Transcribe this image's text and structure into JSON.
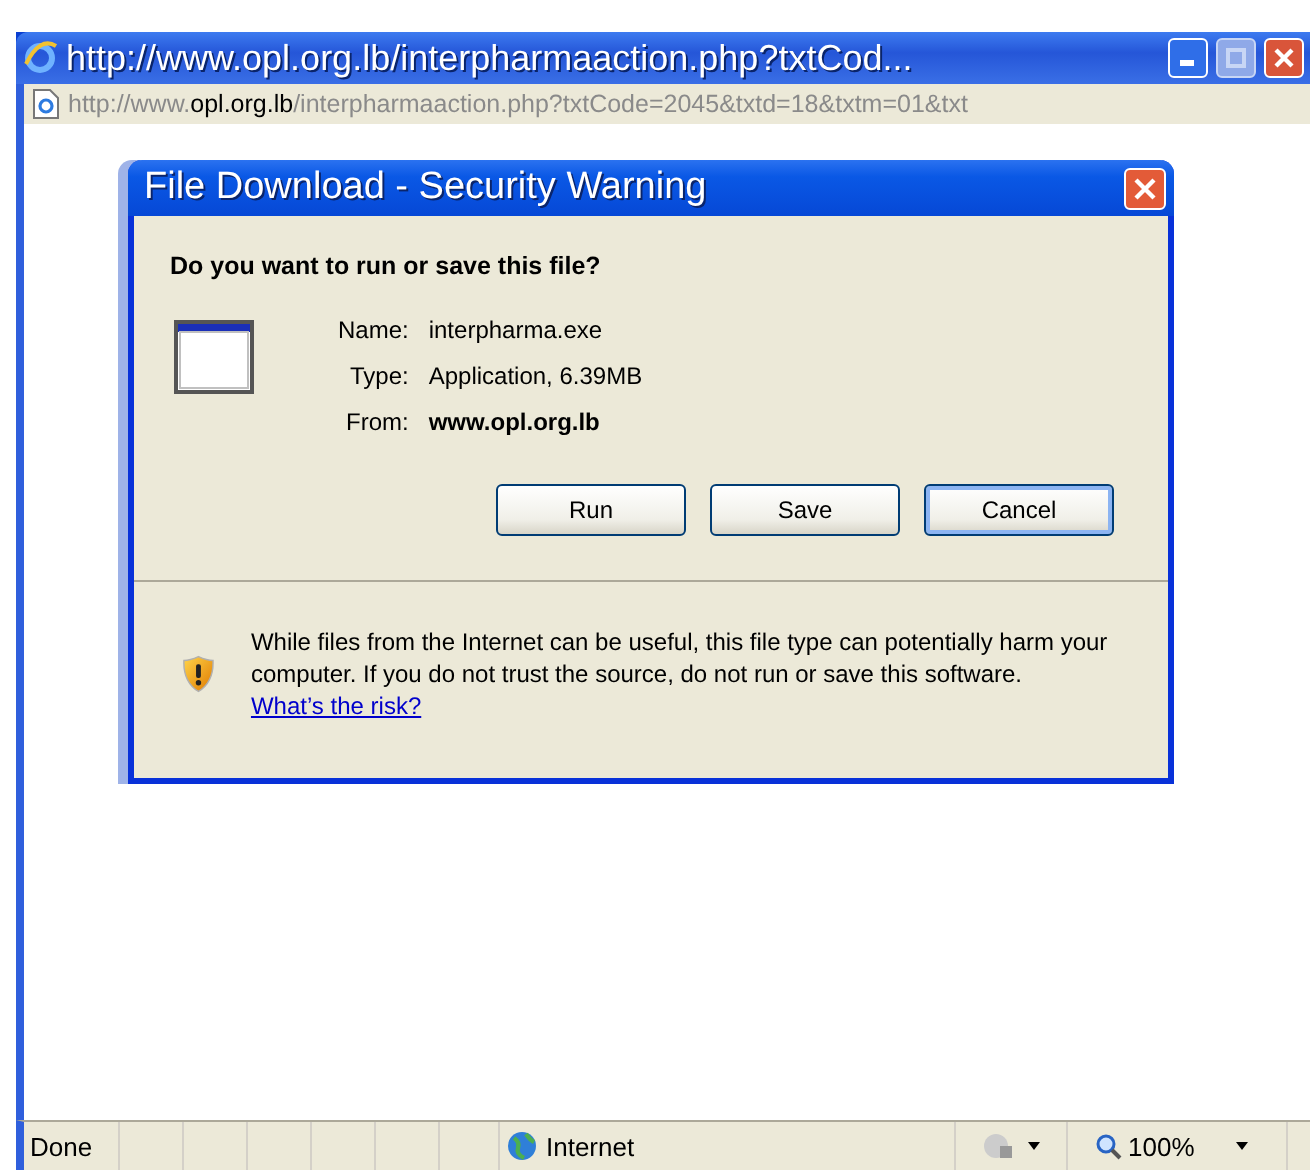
{
  "browser": {
    "title": "http://www.opl.org.lb/interpharmaaction.php?txtCod...",
    "address": {
      "prefix": "http://www.",
      "domain": "opl.org.lb",
      "path": "/interpharmaaction.php?txtCode=2045&txtd=18&txtm=01&txt"
    }
  },
  "dialog": {
    "title": "File Download - Security Warning",
    "question": "Do you want to run or save this file?",
    "fields": [
      {
        "label": "Name:",
        "value": "interpharma.exe",
        "bold": false
      },
      {
        "label": "Type:",
        "value": "Application, 6.39MB",
        "bold": false
      },
      {
        "label": "From:",
        "value": "www.opl.org.lb",
        "bold": true
      }
    ],
    "buttons": [
      {
        "label": "Run",
        "default": false
      },
      {
        "label": "Save",
        "default": false
      },
      {
        "label": "Cancel",
        "default": true
      }
    ],
    "warning": {
      "text": "While files from the Internet can be useful, this file type can potentially harm your computer. If you do not trust the source, do not run or save this software.",
      "link": "What’s the risk?"
    }
  },
  "status_bar": {
    "status": "Done",
    "zone": "Internet",
    "zoom": "100%"
  }
}
